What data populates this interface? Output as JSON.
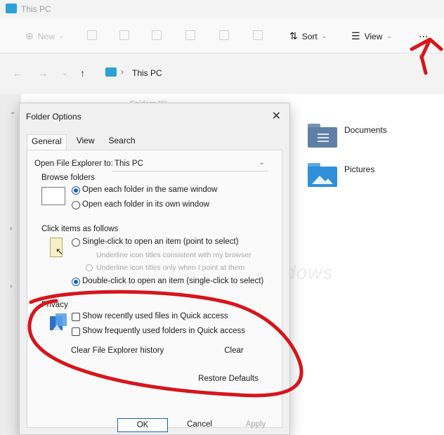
{
  "window": {
    "title": "This PC"
  },
  "commandbar": {
    "new_label": "New",
    "sort_label": "Sort",
    "view_label": "View",
    "more_label": "..."
  },
  "address": {
    "breadcrumb": "This PC"
  },
  "background": {
    "faded_folder_label": "Folders (6)",
    "folders": [
      {
        "label": "Documents",
        "icon": "documents-folder-icon",
        "color": "#5f7fa6"
      },
      {
        "label": "Pictures",
        "icon": "pictures-folder-icon",
        "color": "#2f8fd8"
      }
    ],
    "watermark": "windows"
  },
  "dialog": {
    "title": "Folder Options",
    "tabs": [
      "General",
      "View",
      "Search"
    ],
    "open_explorer_label": "Open File Explorer to:",
    "open_explorer_value": "This PC",
    "browse_folders_label": "Browse folders",
    "browse_options": [
      {
        "label": "Open each folder in the same window",
        "checked": true
      },
      {
        "label": "Open each folder in its own window",
        "checked": false
      }
    ],
    "click_items_label": "Click items as follows",
    "click_options": [
      {
        "label": "Single-click to open an item (point to select)",
        "checked": false
      },
      {
        "label": "Underline icon titles consistent with my browser",
        "checked": false
      },
      {
        "label": "Underline icon titles only when I point at them",
        "checked": false
      },
      {
        "label": "Double-click to open an item (single-click to select)",
        "checked": true
      }
    ],
    "privacy_label": "Privacy",
    "privacy_options": [
      {
        "label": "Show recently used files in Quick access",
        "checked": false
      },
      {
        "label": "Show frequently used folders in Quick access",
        "checked": false
      }
    ],
    "clear_history_label": "Clear File Explorer history",
    "clear_button": "Clear",
    "restore_defaults_button": "Restore Defaults",
    "ok_button": "OK",
    "cancel_button": "Cancel",
    "apply_button": "Apply"
  },
  "colors": {
    "accent": "#1b5fbd",
    "annotation_red": "#d7151b"
  }
}
